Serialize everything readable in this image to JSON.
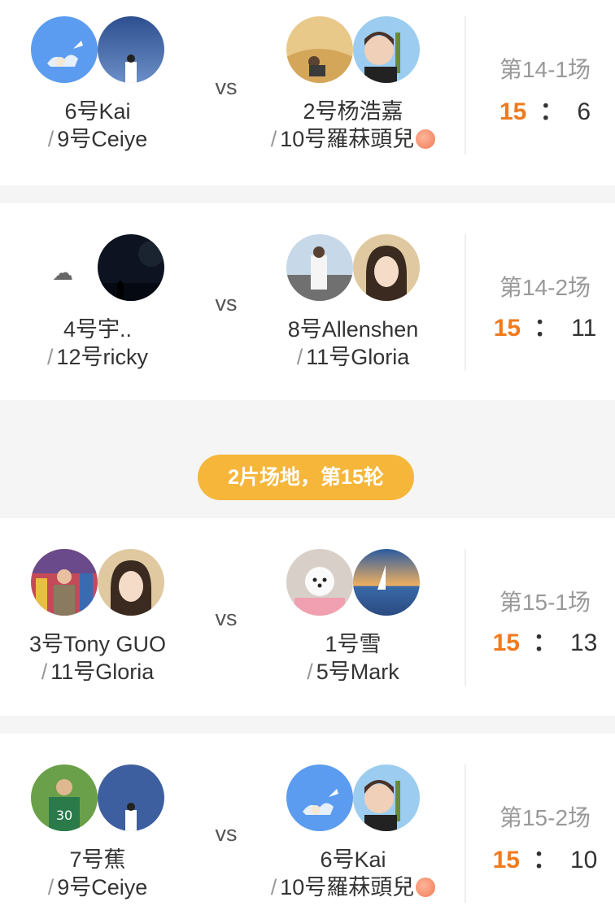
{
  "matches": [
    {
      "round": "第14-1场",
      "team_left": {
        "p1": "6号Kai",
        "p2": "9号Ceiye"
      },
      "team_right": {
        "p1": "2号杨浩嘉",
        "p2": "10号羅菻頭兒"
      },
      "score_left": "15",
      "score_right": "6",
      "vs": "vs"
    },
    {
      "round": "第14-2场",
      "team_left": {
        "p1": "4号宇..",
        "p2": "12号ricky"
      },
      "team_right": {
        "p1": "8号Allenshen",
        "p2": "11号Gloria"
      },
      "score_left": "15",
      "score_right": "11",
      "vs": "vs"
    },
    {
      "round": "第15-1场",
      "team_left": {
        "p1": "3号Tony GUO",
        "p2": "11号Gloria"
      },
      "team_right": {
        "p1": "1号雪",
        "p2": "5号Mark"
      },
      "score_left": "15",
      "score_right": "13",
      "vs": "vs"
    },
    {
      "round": "第15-2场",
      "team_left": {
        "p1": "7号蕉",
        "p2": "9号Ceiye"
      },
      "team_right": {
        "p1": "6号Kai",
        "p2": "10号羅菻頭兒"
      },
      "score_left": "15",
      "score_right": "10",
      "vs": "vs"
    }
  ],
  "banner": "2片场地，第15轮",
  "separator": "/",
  "score_colon": "：",
  "colors": {
    "winner": "#f07a1e",
    "banner": "#f5b63a",
    "page_bg": "#f5f5f5"
  }
}
